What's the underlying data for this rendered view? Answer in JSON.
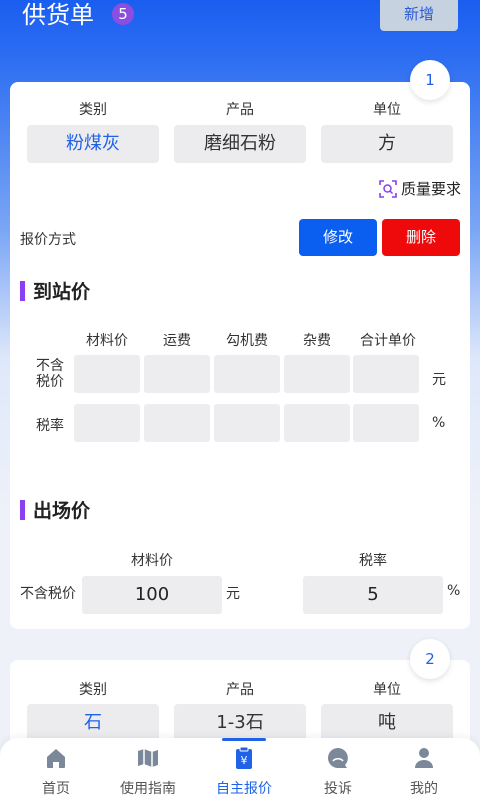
{
  "header": {
    "title": "供货单",
    "badge": "5",
    "add_label": "新增"
  },
  "colors": {
    "accent": "#1f62e8",
    "edit": "#0b5ff0",
    "delete": "#ee0a0a",
    "section_bar": "#8a3ff0",
    "badge": "#8a4fe0"
  },
  "cards": [
    {
      "index": "1",
      "col_labels": {
        "category": "类别",
        "product": "产品",
        "unit": "单位"
      },
      "category": "粉煤灰",
      "product": "磨细石粉",
      "unit": "方",
      "quality_label": "质量要求",
      "quote_method_label": "报价方式",
      "edit_label": "修改",
      "delete_label": "删除",
      "station": {
        "title": "到站价",
        "headers": [
          "材料价",
          "运费",
          "勾机费",
          "杂费",
          "合计单价"
        ],
        "row1_label_line1": "不含",
        "row1_label_line2": "税价",
        "row1_unit": "元",
        "row2_label": "税率",
        "row2_unit": "%"
      },
      "factory": {
        "title": "出场价",
        "material_header": "材料价",
        "tax_header": "税率",
        "row_label": "不含税价",
        "material_value": "100",
        "material_unit": "元",
        "tax_value": "5",
        "tax_unit": "%"
      }
    },
    {
      "index": "2",
      "col_labels": {
        "category": "类别",
        "product": "产品",
        "unit": "单位"
      },
      "category": "石",
      "product": "1-3石",
      "unit": "吨"
    }
  ],
  "tabbar": {
    "items": [
      {
        "label": "首页",
        "icon": "home-icon"
      },
      {
        "label": "使用指南",
        "icon": "map-icon"
      },
      {
        "label": "自主报价",
        "icon": "clipboard-yen-icon"
      },
      {
        "label": "投诉",
        "icon": "complaint-icon"
      },
      {
        "label": "我的",
        "icon": "user-icon"
      }
    ],
    "active_index": 2
  }
}
